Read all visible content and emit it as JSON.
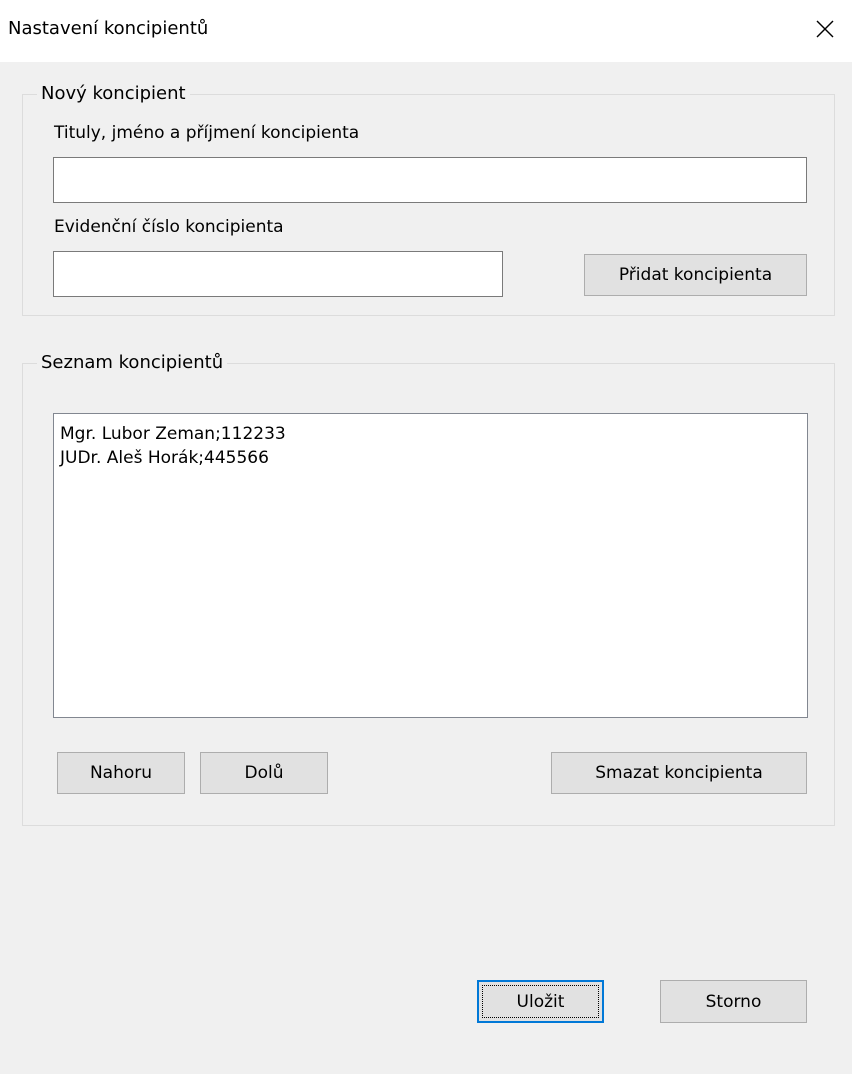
{
  "window": {
    "title": "Nastavení koncipientů",
    "close_icon": "close-icon"
  },
  "new_group": {
    "legend": "Nový koncipient",
    "name_label": "Tituly, jméno a příjmení koncipienta",
    "name_value": "",
    "number_label": "Evidenční číslo koncipienta",
    "number_value": "",
    "add_button": "Přidat koncipienta"
  },
  "list_group": {
    "legend": "Seznam koncipientů",
    "items": [
      "Mgr. Lubor Zeman;112233",
      "JUDr. Aleš Horák;445566"
    ],
    "up_button": "Nahoru",
    "down_button": "Dolů",
    "delete_button": "Smazat koncipienta"
  },
  "footer": {
    "save_button": "Uložit",
    "cancel_button": "Storno"
  },
  "colors": {
    "default_button_border": "#0078d7",
    "background": "#f0f0f0"
  }
}
